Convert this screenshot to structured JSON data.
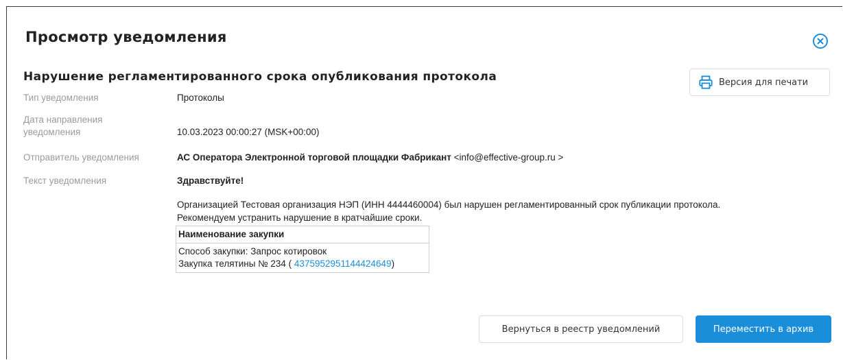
{
  "modal": {
    "title": "Просмотр уведомления",
    "subtitle": "Нарушение регламентированного срока опубликования протокола",
    "print_label": "Версия для печати"
  },
  "fields": {
    "type_label": "Тип уведомления",
    "type_value": "Протоколы",
    "date_label_1": "Дата направления",
    "date_label_2": "уведомления",
    "date_value": "10.03.2023 00:00:27 (MSK+00:00)",
    "sender_label": "Отправитель уведомления",
    "sender_name": "АС Оператора Электронной торговой площадки Фабрикант",
    "sender_email": " <info@effective-group.ru >",
    "text_label": "Текст уведомления"
  },
  "message": {
    "greeting": "Здравствуйте!",
    "line1": "Организацией Тестовая организация НЭП (ИНН 4444460004) был нарушен регламентированный срок публикации протокола.",
    "line2": "Рекомендуем устранить нарушение в кратчайшие сроки.",
    "table_header": "Наименование закупки",
    "method": "Способ закупки: Запрос котировок",
    "purchase_prefix": "Закупка телятины № 234 ( ",
    "purchase_number": "4375952951144424649",
    "purchase_suffix": ")"
  },
  "buttons": {
    "back": "Вернуться в реестр уведомлений",
    "archive": "Переместить в архив"
  },
  "colors": {
    "accent": "#1a8ed8",
    "label": "#9a9a9a"
  },
  "icons": {
    "close": "close-circle-icon",
    "print": "printer-icon"
  }
}
